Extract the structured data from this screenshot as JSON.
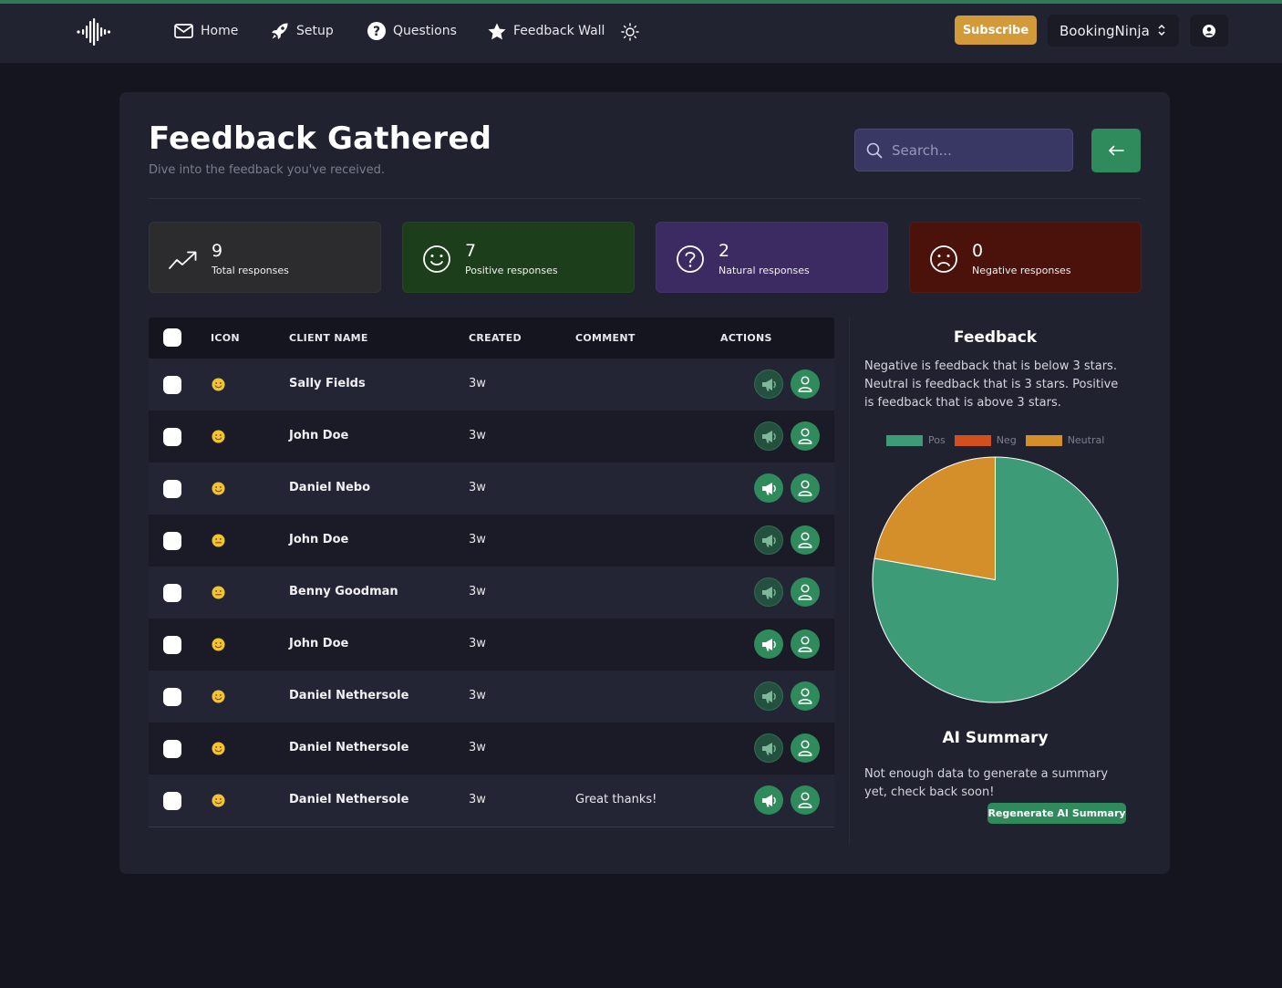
{
  "nav": {
    "items": [
      {
        "label": "Home",
        "icon": "mail-icon"
      },
      {
        "label": "Setup",
        "icon": "rocket-icon"
      },
      {
        "label": "Questions",
        "icon": "question-circle-icon"
      },
      {
        "label": "Feedback Wall",
        "icon": "star-icon"
      }
    ],
    "subscribe_label": "Subscribe",
    "org_name": "BookingNinja"
  },
  "header": {
    "title": "Feedback Gathered",
    "subtitle": "Dive into the feedback you've received.",
    "search_placeholder": "Search..."
  },
  "stats": [
    {
      "value": "9",
      "label": "Total responses",
      "bg": "#2c2c2f",
      "icon": "trend-up-icon"
    },
    {
      "value": "7",
      "label": "Positive responses",
      "bg": "#1d3e1b",
      "icon": "smile-icon"
    },
    {
      "value": "2",
      "label": "Natural responses",
      "bg": "#3c2a62",
      "icon": "question-circle-icon"
    },
    {
      "value": "0",
      "label": "Negative responses",
      "bg": "#4a120a",
      "icon": "frown-icon"
    }
  ],
  "table": {
    "headers": {
      "icon": "ICON",
      "client_name": "CLIENT NAME",
      "created": "CREATED",
      "comment": "COMMENT",
      "actions": "ACTIONS"
    },
    "rows": [
      {
        "emoji": "😊",
        "mood": "positive",
        "name": "Sally Fields",
        "created": "3w",
        "comment": "",
        "published": false
      },
      {
        "emoji": "😊",
        "mood": "positive",
        "name": "John Doe",
        "created": "3w",
        "comment": "",
        "published": false
      },
      {
        "emoji": "😊",
        "mood": "positive",
        "name": "Daniel Nebo",
        "created": "3w",
        "comment": "",
        "published": true
      },
      {
        "emoji": "😐",
        "mood": "neutral",
        "name": "John Doe",
        "created": "3w",
        "comment": "",
        "published": false
      },
      {
        "emoji": "😐",
        "mood": "neutral",
        "name": "Benny Goodman",
        "created": "3w",
        "comment": "",
        "published": false
      },
      {
        "emoji": "😊",
        "mood": "positive",
        "name": "John Doe",
        "created": "3w",
        "comment": "",
        "published": true
      },
      {
        "emoji": "😊",
        "mood": "positive",
        "name": "Daniel Nethersole",
        "created": "3w",
        "comment": "",
        "published": false
      },
      {
        "emoji": "😊",
        "mood": "positive",
        "name": "Daniel Nethersole",
        "created": "3w",
        "comment": "",
        "published": false
      },
      {
        "emoji": "😊",
        "mood": "positive",
        "name": "Daniel Nethersole",
        "created": "3w",
        "comment": "Great thanks!",
        "published": true
      }
    ]
  },
  "feedback_panel": {
    "title": "Feedback",
    "description": "Negative is feedback that is below 3 stars. Neutral is feedback that is 3 stars. Positive is feedback that is above 3 stars."
  },
  "chart_data": {
    "type": "pie",
    "categories": [
      "Pos",
      "Neg",
      "Neutral"
    ],
    "values": [
      7,
      0,
      2
    ],
    "colors": [
      "#3d9b78",
      "#d24f1e",
      "#d58f2a"
    ],
    "legend": "top"
  },
  "ai_summary": {
    "title": "AI Summary",
    "text": "Not enough data to generate a summary yet, check back soon!",
    "button_label": "Regenerate AI Summary"
  }
}
